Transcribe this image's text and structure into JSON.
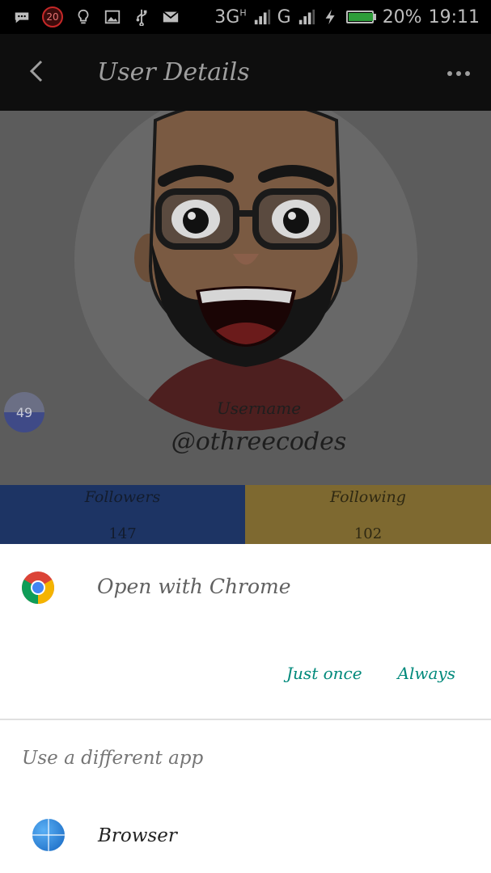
{
  "status_bar": {
    "notification_count": "20",
    "network_3g": "3G",
    "network_3g_sup": "H",
    "network_g": "G",
    "battery_percent": "20%",
    "battery_level": 0.2,
    "time": "19:11",
    "icons": [
      "message-icon",
      "notification-badge",
      "lightbulb-icon",
      "image-icon",
      "usb-icon",
      "mail-icon",
      "signal-icon",
      "signal-icon",
      "charging-icon",
      "battery-icon"
    ]
  },
  "app_bar": {
    "title": "User Details",
    "back_icon": "back-arrow-icon",
    "more_icon": "more-horizontal-icon",
    "background": "#0e0e0e"
  },
  "profile": {
    "badge_count": "49",
    "username_label": "Username",
    "handle": "@othreecodes",
    "stats": [
      {
        "label": "Followers",
        "value": "147",
        "color": "#1d3464"
      },
      {
        "label": "Following",
        "value": "102",
        "color": "#7e6930"
      }
    ]
  },
  "chooser": {
    "open_with_label": "Open with Chrome",
    "chrome_icon": "chrome-icon",
    "just_once_label": "Just once",
    "always_label": "Always",
    "accent_color": "#00897b",
    "different_app_label": "Use a different app",
    "apps": [
      {
        "name": "Browser",
        "icon": "browser-icon"
      }
    ]
  }
}
